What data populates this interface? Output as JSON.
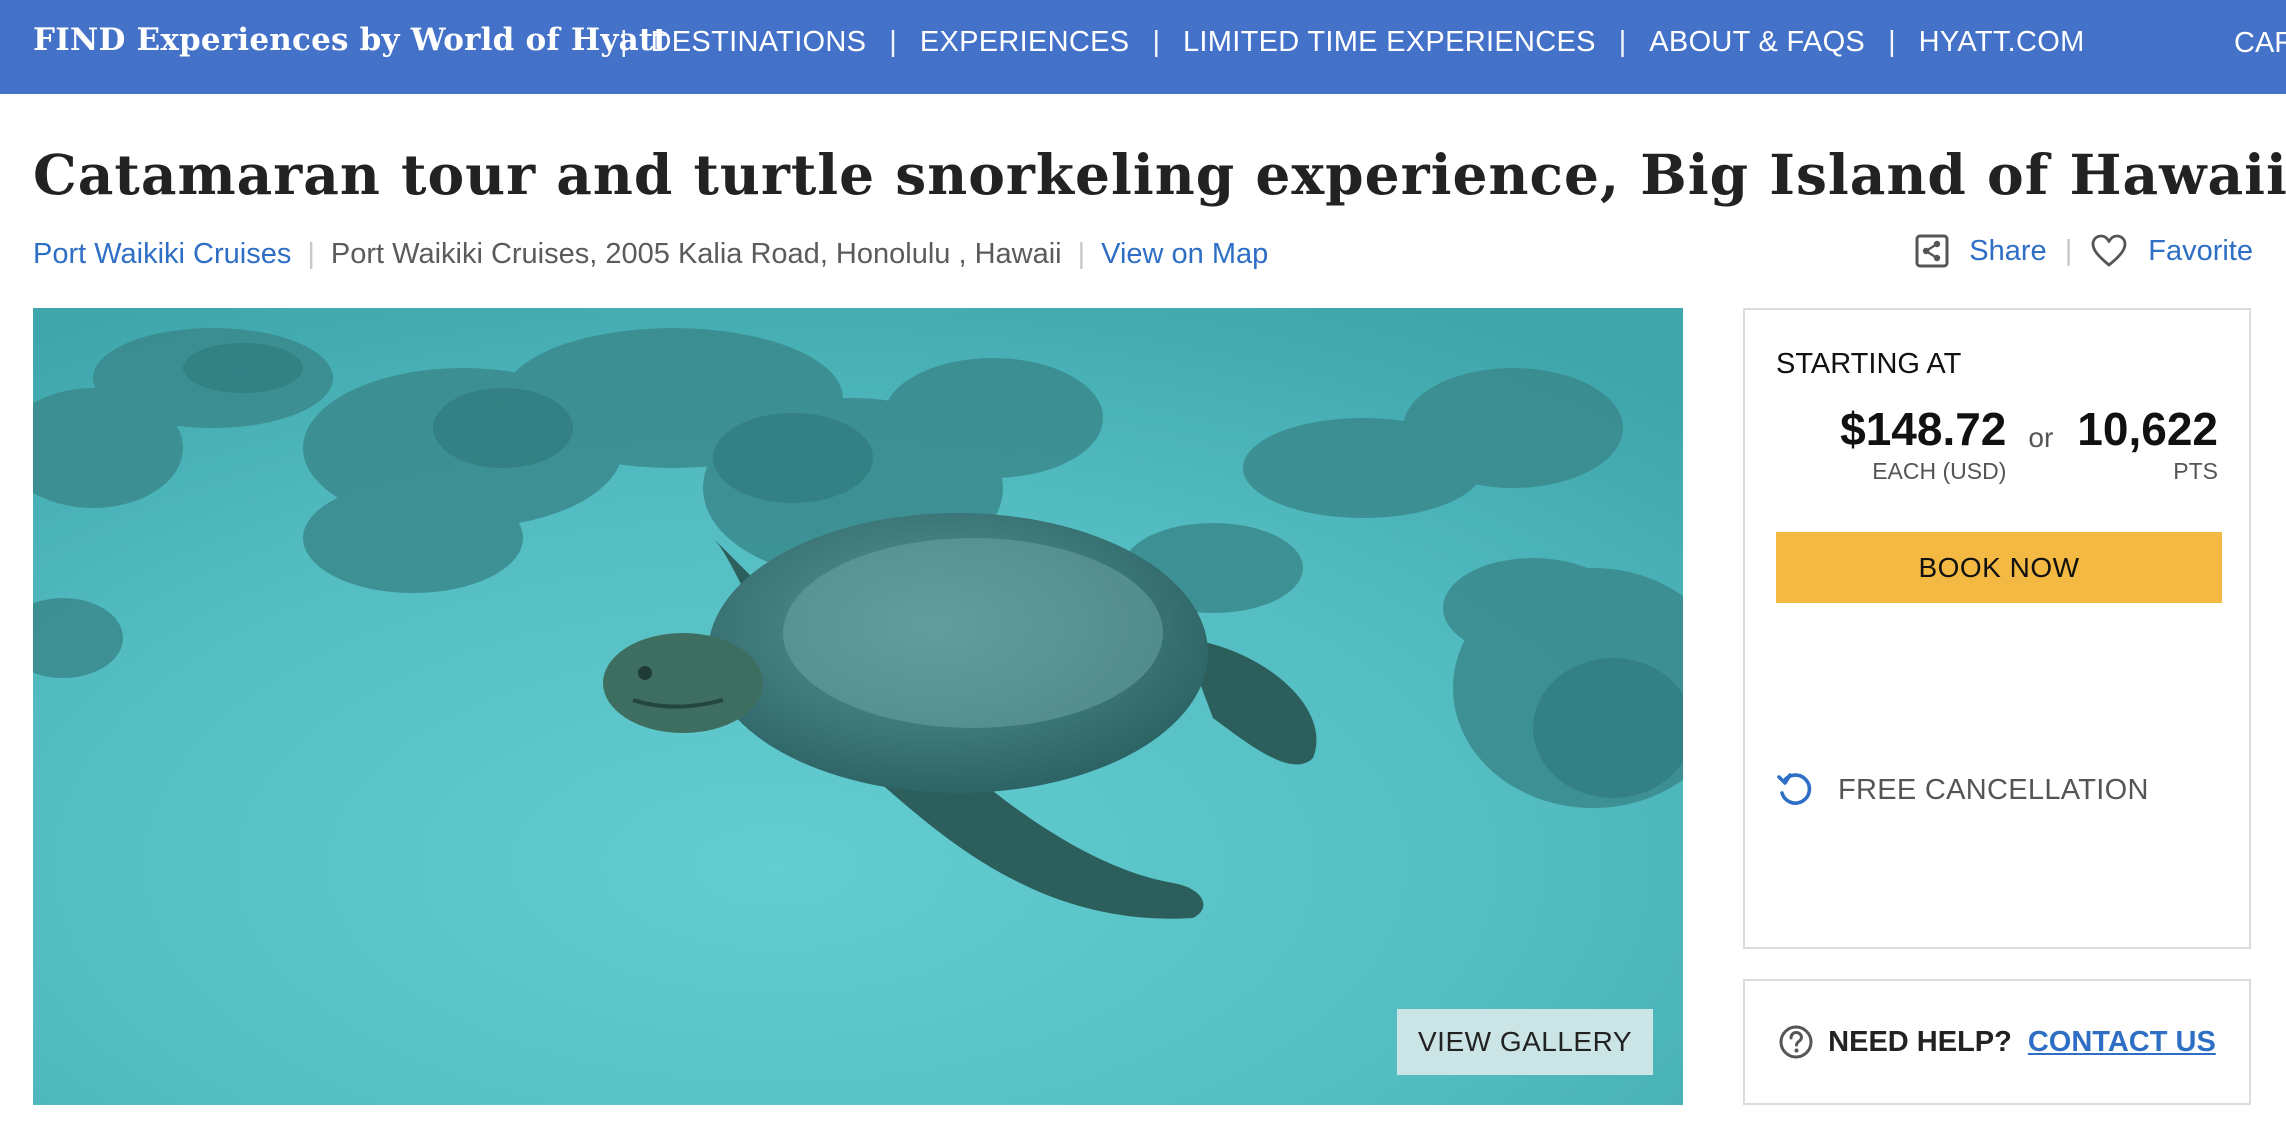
{
  "nav": {
    "brand": "FIND Experiences by World of Hyatt",
    "separator": "|",
    "links": [
      "DESTINATIONS",
      "EXPERIENCES",
      "LIMITED TIME EXPERIENCES",
      "ABOUT & FAQS",
      "HYATT.COM"
    ],
    "cart_label": "CART"
  },
  "page": {
    "title": "Catamaran tour and turtle snorkeling experience, Big Island of Hawaii",
    "vendor": "Port Waikiki Cruises",
    "address": "Port Waikiki Cruises, 2005 Kalia Road, Honolulu , Hawaii",
    "map_link": "View on Map",
    "share_label": "Share",
    "favorite_label": "Favorite"
  },
  "hero": {
    "gallery_label": "VIEW GALLERY"
  },
  "booking": {
    "starting_label": "STARTING AT",
    "price": "$148.72",
    "price_unit": "EACH (USD)",
    "or_label": "or",
    "points": "10,622",
    "points_unit": "PTS",
    "book_label": "BOOK NOW",
    "cancellation": "FREE CANCELLATION"
  },
  "help": {
    "need_help": "NEED HELP?",
    "contact": "CONTACT US"
  },
  "colors": {
    "nav_bg": "#4472c9",
    "link": "#2e6ec4",
    "book_button": "#f4b942",
    "water": "#4fb8bd"
  },
  "icons": [
    "share-icon",
    "heart-icon",
    "refresh-icon",
    "question-circle-icon"
  ]
}
